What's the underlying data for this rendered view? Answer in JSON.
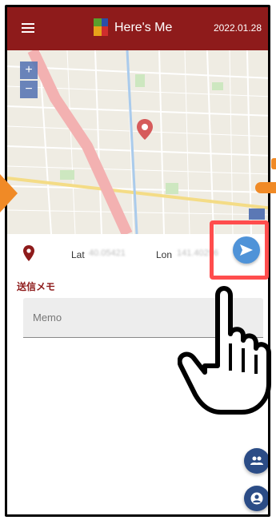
{
  "header": {
    "title": "Here's Me",
    "date": "2022.01.28",
    "bg_color": "#8e1b1b"
  },
  "map": {
    "zoom_in": "+",
    "zoom_out": "−"
  },
  "location": {
    "lat_label": "Lat",
    "lat_value": "40.05421",
    "lon_label": "Lon",
    "lon_value": "141.40296"
  },
  "memo": {
    "heading": "送信メモ",
    "placeholder": "Memo"
  },
  "icons": {
    "menu": "menu-icon",
    "send": "send-icon",
    "location": "location-pin-icon",
    "group": "group-icon",
    "account": "account-icon"
  },
  "colors": {
    "accent_orange": "#f08a26",
    "highlight_red": "#ff4d4d",
    "send_blue": "#4f93d8",
    "fab_navy": "#2b4c86"
  }
}
